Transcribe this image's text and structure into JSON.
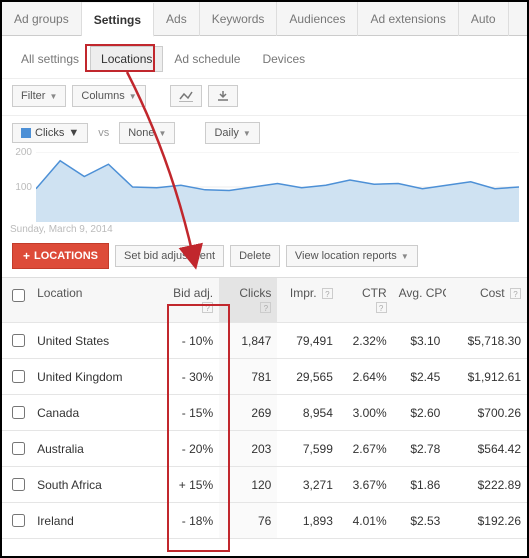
{
  "tabs_top": {
    "items": [
      "Ad groups",
      "Settings",
      "Ads",
      "Keywords",
      "Audiences",
      "Ad extensions",
      "Auto"
    ],
    "active_index": 1
  },
  "tabs_sub": {
    "items": [
      "All settings",
      "Locations",
      "Ad schedule",
      "Devices"
    ],
    "active_index": 1
  },
  "toolbar": {
    "filter": "Filter",
    "columns": "Columns"
  },
  "chart_controls": {
    "metric": "Clicks",
    "vs": "vs",
    "none": "None",
    "granularity": "Daily"
  },
  "chart_data": {
    "type": "area",
    "ylim": [
      0,
      200
    ],
    "yticks": [
      100,
      200
    ],
    "date_label": "Sunday, March 9, 2014",
    "series": [
      {
        "name": "Clicks",
        "color": "#4d90d6",
        "values": [
          95,
          175,
          130,
          165,
          100,
          98,
          105,
          92,
          90,
          100,
          110,
          98,
          105,
          120,
          108,
          110,
          95,
          105,
          115,
          95,
          100
        ]
      }
    ]
  },
  "actions": {
    "locations_btn": "LOCATIONS",
    "plus": "+",
    "set_bid": "Set bid adjustment",
    "delete": "Delete",
    "view_reports": "View location reports"
  },
  "table": {
    "headers": {
      "location": "Location",
      "bid_adj": "Bid adj.",
      "clicks": "Clicks",
      "impr": "Impr.",
      "ctr": "CTR",
      "avg_cpc": "Avg. CPC",
      "cost": "Cost"
    },
    "rows": [
      {
        "location": "United States",
        "bid_adj": "- 10%",
        "clicks": "1,847",
        "impr": "79,491",
        "ctr": "2.32%",
        "avg_cpc": "$3.10",
        "cost": "$5,718.30"
      },
      {
        "location": "United Kingdom",
        "bid_adj": "- 30%",
        "clicks": "781",
        "impr": "29,565",
        "ctr": "2.64%",
        "avg_cpc": "$2.45",
        "cost": "$1,912.61"
      },
      {
        "location": "Canada",
        "bid_adj": "- 15%",
        "clicks": "269",
        "impr": "8,954",
        "ctr": "3.00%",
        "avg_cpc": "$2.60",
        "cost": "$700.26"
      },
      {
        "location": "Australia",
        "bid_adj": "- 20%",
        "clicks": "203",
        "impr": "7,599",
        "ctr": "2.67%",
        "avg_cpc": "$2.78",
        "cost": "$564.42"
      },
      {
        "location": "South Africa",
        "bid_adj": "+ 15%",
        "clicks": "120",
        "impr": "3,271",
        "ctr": "3.67%",
        "avg_cpc": "$1.86",
        "cost": "$222.89"
      },
      {
        "location": "Ireland",
        "bid_adj": "- 18%",
        "clicks": "76",
        "impr": "1,893",
        "ctr": "4.01%",
        "avg_cpc": "$2.53",
        "cost": "$192.26"
      }
    ]
  }
}
